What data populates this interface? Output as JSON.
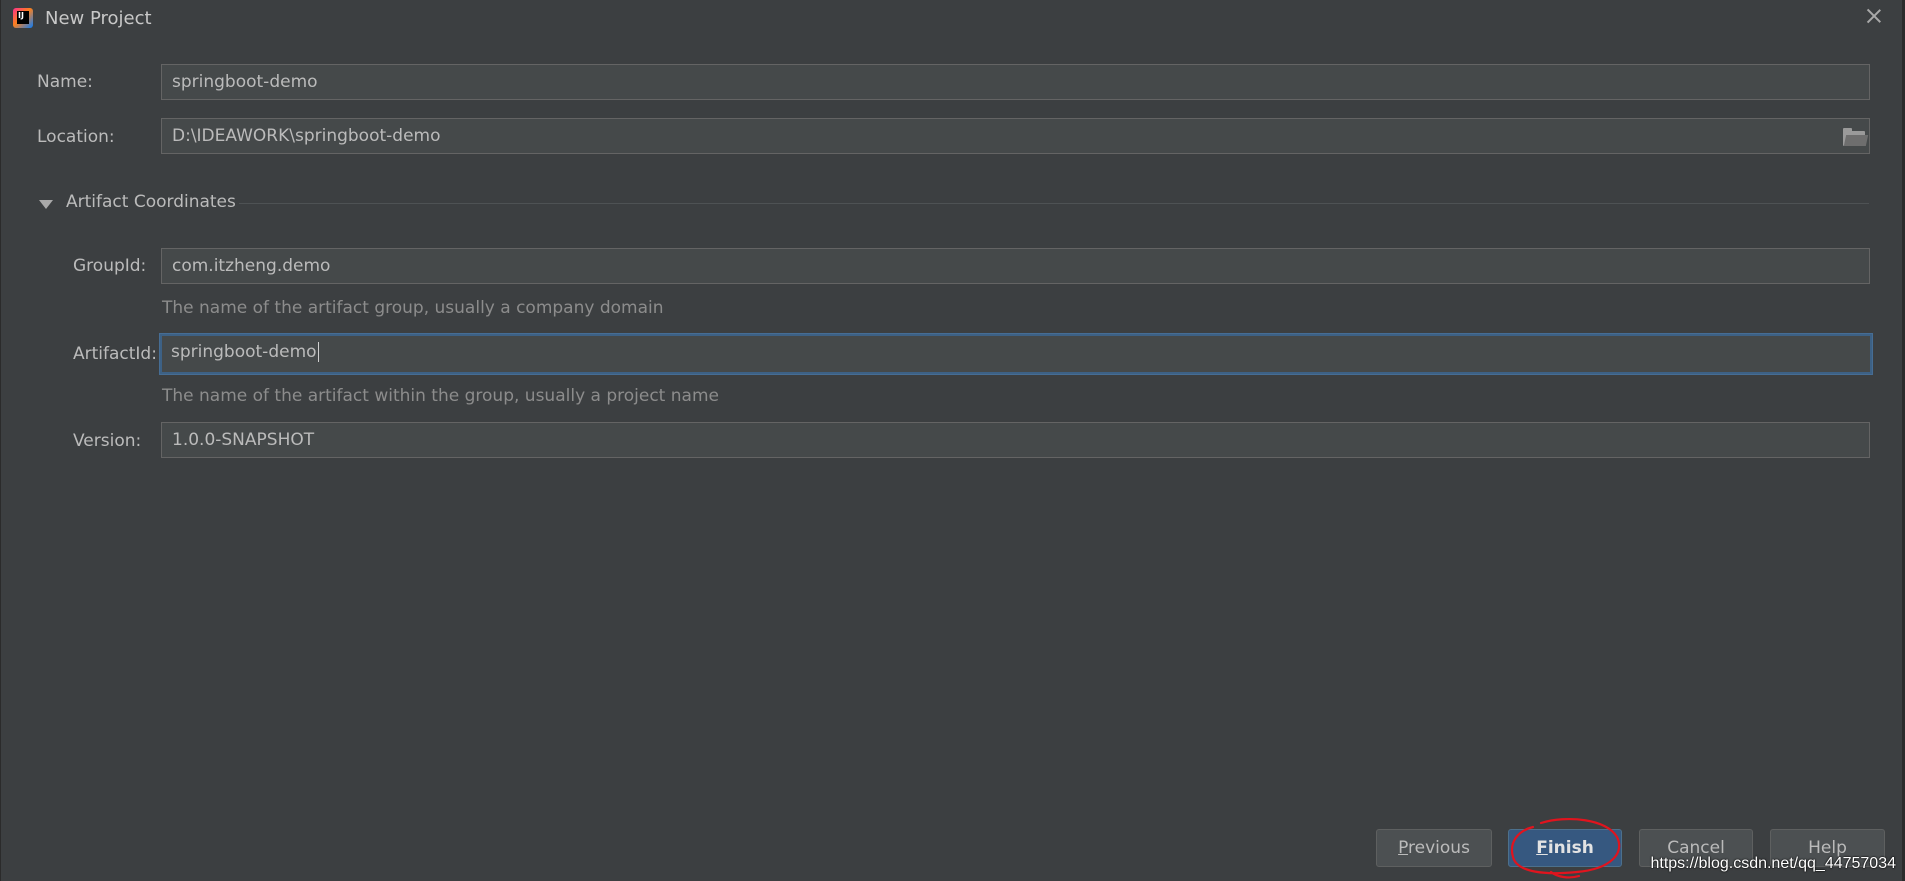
{
  "window": {
    "title": "New Project",
    "app_icon": "intellij-idea-icon",
    "close_icon": "close-icon"
  },
  "fields": {
    "name": {
      "label": "Name:",
      "value": "springboot-demo"
    },
    "location": {
      "label": "Location:",
      "value": "D:\\IDEAWORK\\springboot-demo",
      "browse_icon": "folder-icon"
    },
    "group_id": {
      "label": "GroupId:",
      "value": "com.itzheng.demo",
      "hint": "The name of the artifact group, usually a company domain"
    },
    "artifact_id": {
      "label": "ArtifactId:",
      "value": "springboot-demo",
      "hint": "The name of the artifact within the group, usually a project name"
    },
    "version": {
      "label": "Version:",
      "value": "1.0.0-SNAPSHOT"
    }
  },
  "section": {
    "title": "Artifact Coordinates",
    "expanded": true,
    "toggle_icon": "triangle-down-icon"
  },
  "buttons": {
    "previous": {
      "mnemonic": "P",
      "rest": "revious"
    },
    "finish": {
      "mnemonic": "F",
      "rest": "inish"
    },
    "cancel": {
      "label": "Cancel"
    },
    "help": {
      "label": "Help"
    }
  },
  "annotation": {
    "color": "#e0141e",
    "shape": "hand-drawn-circle"
  },
  "watermark": "https://blog.csdn.net/qq_44757034",
  "colors": {
    "background": "#3c3f41",
    "field_background": "#45494a",
    "focus_border": "#3d6185",
    "primary_button": "#365880"
  }
}
